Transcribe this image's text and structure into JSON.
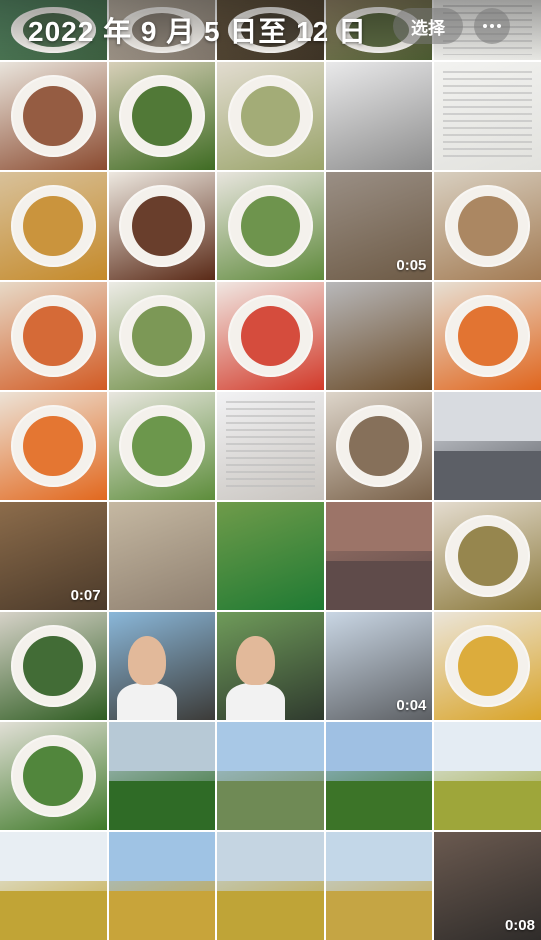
{
  "header": {
    "title": "2022 年 9 月 5 日至 12 日",
    "select_label": "选择",
    "more_icon": "ellipsis-icon"
  },
  "grid": {
    "rows": [
      [
        {
          "kind": "food",
          "colors": [
            "#5b8f6b",
            "#3c5e3f"
          ]
        },
        {
          "kind": "food",
          "colors": [
            "#c0b6a8",
            "#7f756a"
          ]
        },
        {
          "kind": "food",
          "colors": [
            "#6b5b44",
            "#3d3325"
          ]
        },
        {
          "kind": "food",
          "colors": [
            "#9a8b6c",
            "#4a5a30"
          ]
        },
        {
          "kind": "doc",
          "colors": [
            "#f3f3f1",
            "#e6e6e2"
          ]
        }
      ],
      [
        {
          "kind": "food",
          "colors": [
            "#e9e4dc",
            "#8b4b30"
          ]
        },
        {
          "kind": "food",
          "colors": [
            "#d7cfb8",
            "#3f6c23"
          ]
        },
        {
          "kind": "food",
          "colors": [
            "#e2dcd0",
            "#9aa46a"
          ]
        },
        {
          "kind": "photo",
          "colors": [
            "#e9e9ea",
            "#8d8d8d"
          ]
        },
        {
          "kind": "doc",
          "colors": [
            "#f2f2f0",
            "#e2e2de"
          ]
        }
      ],
      [
        {
          "kind": "food",
          "colors": [
            "#d8c19a",
            "#c58a2a"
          ]
        },
        {
          "kind": "food",
          "colors": [
            "#ede8e0",
            "#5a2a17"
          ]
        },
        {
          "kind": "food",
          "colors": [
            "#e8e5de",
            "#5f8a3c"
          ]
        },
        {
          "kind": "video",
          "colors": [
            "#9a8f85",
            "#6d5a45"
          ],
          "duration": "0:05"
        },
        {
          "kind": "food",
          "colors": [
            "#d8cfc0",
            "#a37b53"
          ]
        }
      ],
      [
        {
          "kind": "food",
          "colors": [
            "#e7d9c7",
            "#d25b24"
          ]
        },
        {
          "kind": "food",
          "colors": [
            "#ecebe5",
            "#6f8e46"
          ]
        },
        {
          "kind": "food",
          "colors": [
            "#f0e7e2",
            "#d23a2a"
          ]
        },
        {
          "kind": "photo",
          "colors": [
            "#b8b8ba",
            "#6a4b28"
          ]
        },
        {
          "kind": "food",
          "colors": [
            "#e7dfd3",
            "#e0661e"
          ]
        }
      ],
      [
        {
          "kind": "food",
          "colors": [
            "#ece2d6",
            "#e2681e"
          ]
        },
        {
          "kind": "food",
          "colors": [
            "#e8e6df",
            "#5d8d3b"
          ]
        },
        {
          "kind": "screen",
          "colors": [
            "#f2f2f4",
            "#c8c4bf"
          ]
        },
        {
          "kind": "food",
          "colors": [
            "#ddd5ca",
            "#7a624a"
          ]
        },
        {
          "kind": "street",
          "colors": [
            "#d8dbe0",
            "#5c5f66"
          ]
        }
      ],
      [
        {
          "kind": "video",
          "colors": [
            "#8c6c4b",
            "#4b3a2a"
          ],
          "duration": "0:07"
        },
        {
          "kind": "photo",
          "colors": [
            "#c5b8a2",
            "#8f8070"
          ]
        },
        {
          "kind": "photo",
          "colors": [
            "#6f9b4a",
            "#1f7a33"
          ]
        },
        {
          "kind": "sky",
          "colors": [
            "#9c7468",
            "#5f4b4a"
          ]
        },
        {
          "kind": "food",
          "colors": [
            "#e4dccf",
            "#8c7a3d"
          ]
        }
      ],
      [
        {
          "kind": "food",
          "colors": [
            "#d6d2c8",
            "#2f5d22"
          ]
        },
        {
          "kind": "people",
          "colors": [
            "#8ab7d9",
            "#3c3b38"
          ]
        },
        {
          "kind": "people",
          "colors": [
            "#6f9b5a",
            "#2f3a2e"
          ]
        },
        {
          "kind": "video",
          "colors": [
            "#c9d6e4",
            "#5d6064"
          ],
          "duration": "0:04"
        },
        {
          "kind": "food",
          "colors": [
            "#ebe5d9",
            "#d9a429"
          ]
        }
      ],
      [
        {
          "kind": "food",
          "colors": [
            "#e1dfd6",
            "#3f7a29"
          ]
        },
        {
          "kind": "field",
          "colors": [
            "#b7c9d6",
            "#2f6b26"
          ]
        },
        {
          "kind": "field",
          "colors": [
            "#a8c8e6",
            "#6f8a55"
          ]
        },
        {
          "kind": "field",
          "colors": [
            "#9fc0e3",
            "#3c7428"
          ]
        },
        {
          "kind": "field",
          "colors": [
            "#e4ecf3",
            "#9ea63a"
          ]
        }
      ],
      [
        {
          "kind": "field",
          "colors": [
            "#e8eef3",
            "#c1a436"
          ]
        },
        {
          "kind": "field",
          "colors": [
            "#9fc3e4",
            "#c8a43a"
          ]
        },
        {
          "kind": "field",
          "colors": [
            "#c5d5e2",
            "#bfa437"
          ]
        },
        {
          "kind": "field",
          "colors": [
            "#c3d7e8",
            "#c5a544"
          ]
        },
        {
          "kind": "video",
          "colors": [
            "#6b5a50",
            "#2f2c2a"
          ],
          "duration": "0:08"
        }
      ]
    ]
  }
}
